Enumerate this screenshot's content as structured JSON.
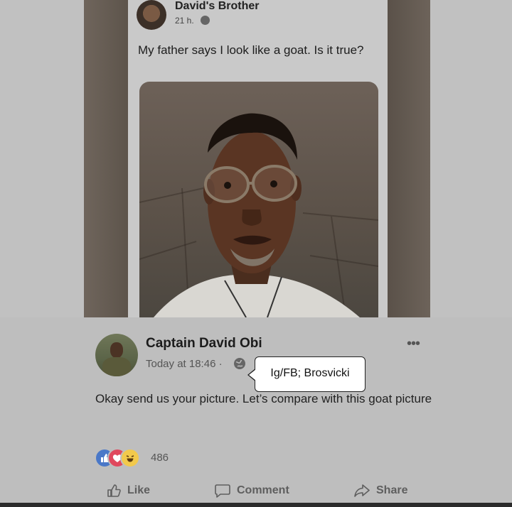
{
  "inner_post": {
    "author": "David's Brother",
    "time": "21 h.",
    "text": "My father says I look like a goat. Is it true?"
  },
  "post": {
    "author": "Captain David Obi",
    "time": "Today at 18:46 ·",
    "text": "Okay send us your picture. Let’s compare with this goat picture",
    "reaction_count": "486"
  },
  "watermark": "Ig/FB; Brosvicki",
  "actions": {
    "like": "Like",
    "comment": "Comment",
    "share": "Share"
  },
  "colors": {
    "like": "#4a78c8",
    "love": "#e0485d",
    "haha": "#f2c94c"
  }
}
